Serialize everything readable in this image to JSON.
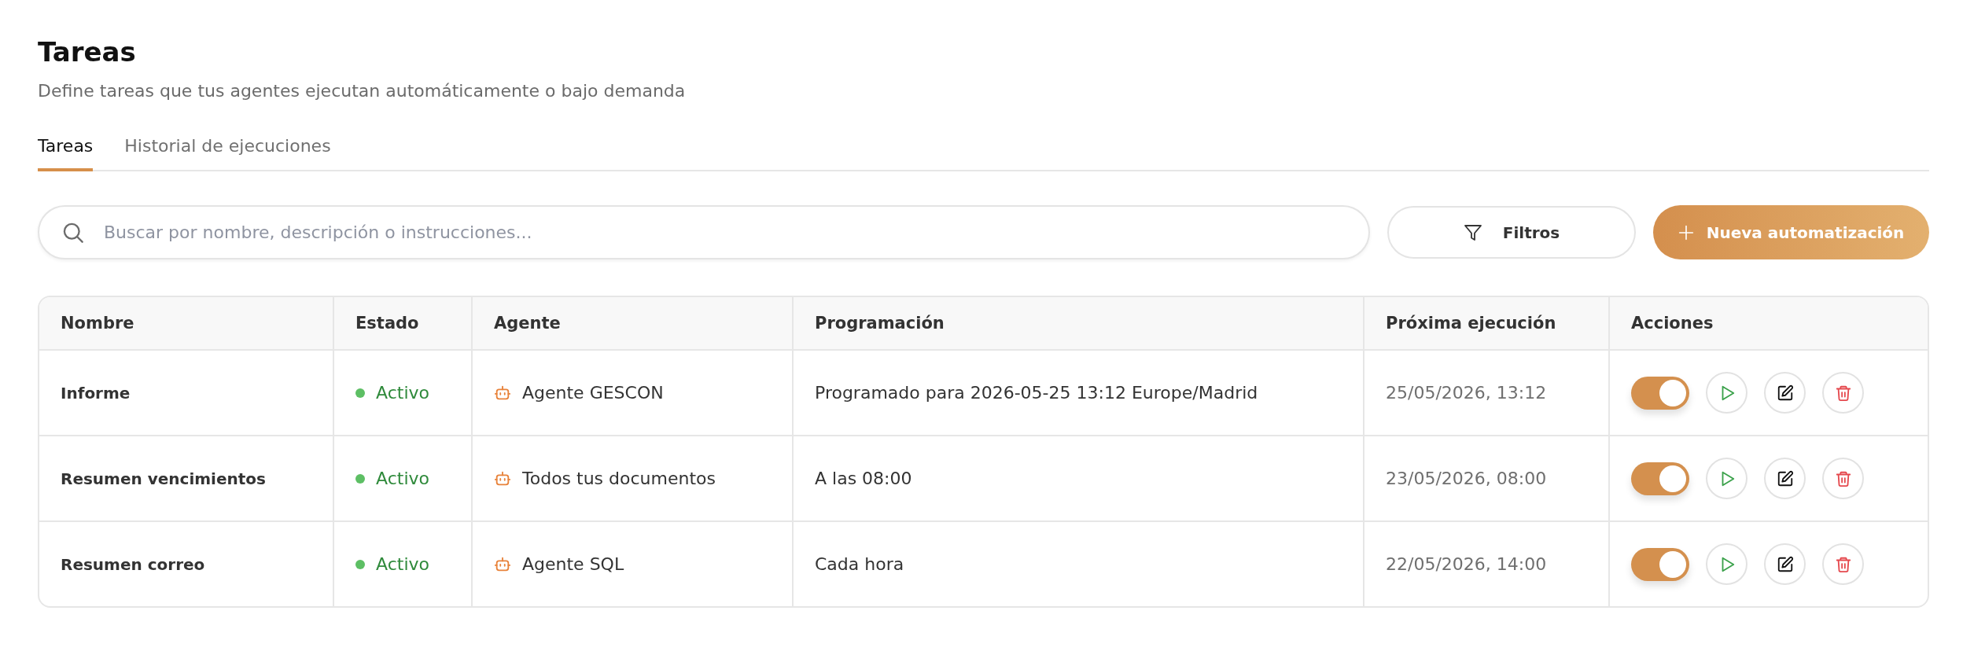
{
  "header": {
    "title": "Tareas",
    "subtitle": "Define tareas que tus agentes ejecutan automáticamente o bajo demanda"
  },
  "tabs": [
    {
      "label": "Tareas",
      "selected": true
    },
    {
      "label": "Historial de ejecuciones",
      "selected": false
    }
  ],
  "search": {
    "placeholder": "Buscar por nombre, descripción o instrucciones..."
  },
  "filter_button": {
    "label": "Filtros"
  },
  "new_button": {
    "label": "Nueva automatización"
  },
  "table": {
    "columns": [
      "Nombre",
      "Estado",
      "Agente",
      "Programación",
      "Próxima ejecución",
      "Acciones"
    ],
    "rows": [
      {
        "name": "Informe",
        "status": "Activo",
        "status_active": true,
        "agent": "Agente GESCON",
        "schedule": "Programado para 2026-05-25 13:12 Europe/Madrid",
        "next_run": "25/05/2026, 13:12",
        "enabled": true
      },
      {
        "name": "Resumen vencimientos",
        "status": "Activo",
        "status_active": true,
        "agent": "Todos tus documentos",
        "schedule": "A las 08:00",
        "next_run": "23/05/2026, 08:00",
        "enabled": true
      },
      {
        "name": "Resumen correo",
        "status": "Activo",
        "status_active": true,
        "agent": "Agente SQL",
        "schedule": "Cada hora",
        "next_run": "22/05/2026, 14:00",
        "enabled": true
      }
    ]
  }
}
